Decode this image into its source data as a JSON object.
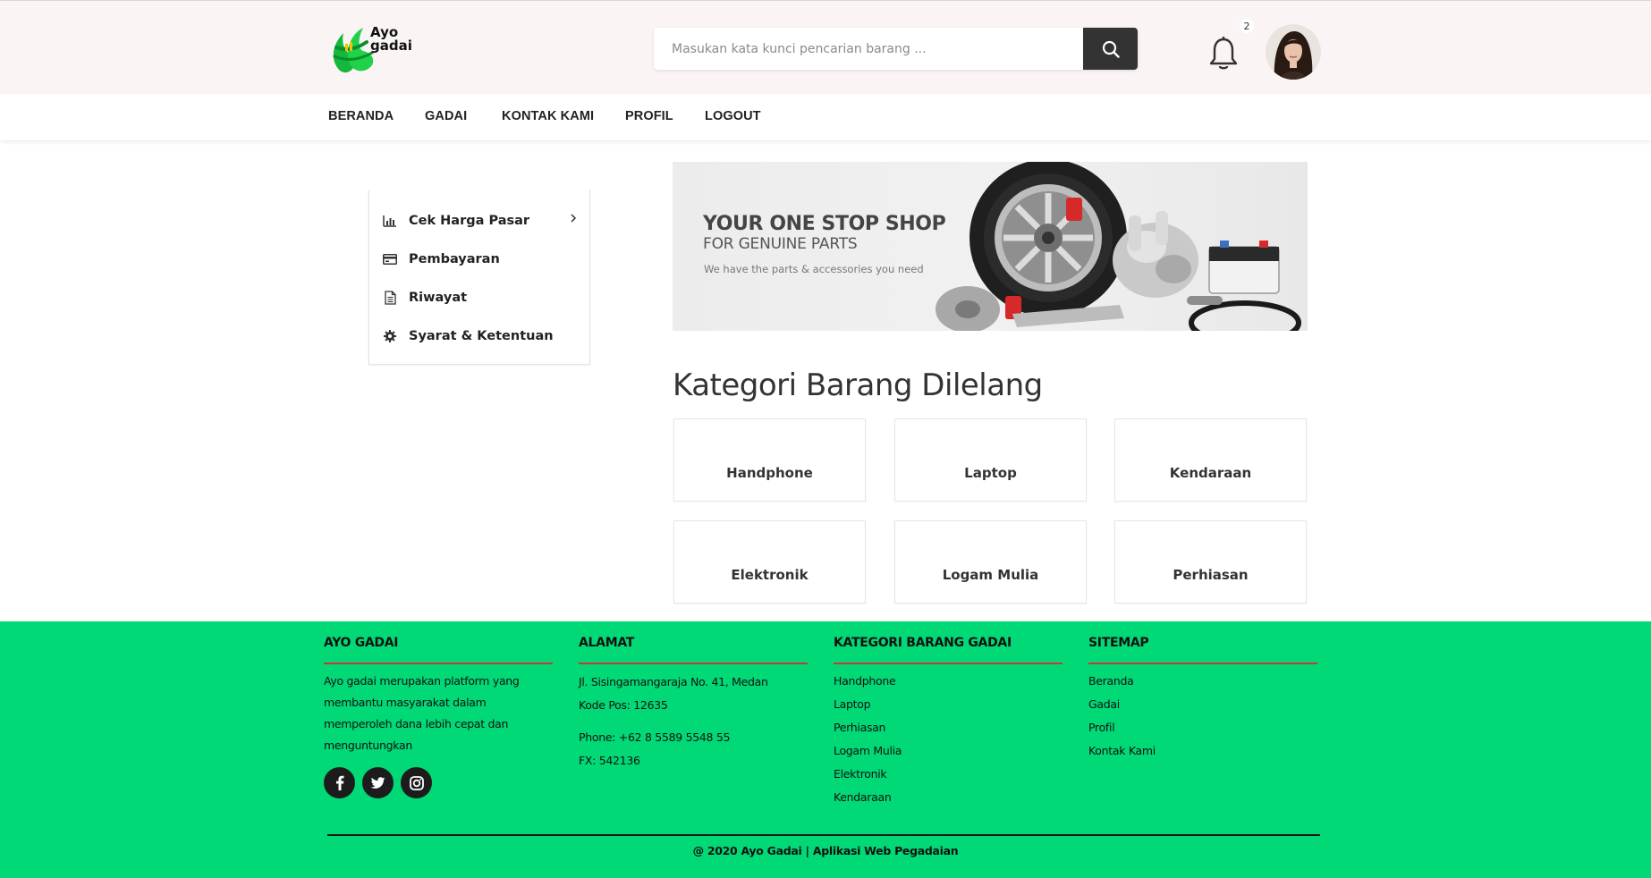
{
  "header": {
    "logo_line1": "Ayo",
    "logo_line2": "gadai",
    "search_placeholder": "Masukan kata kunci pencarian barang ...",
    "search_icon": "search-icon",
    "notification_icon": "bell-icon",
    "notification_count": "2",
    "avatar": "user-avatar"
  },
  "nav": {
    "items": [
      {
        "label": "BERANDA"
      },
      {
        "label": "GADAI"
      },
      {
        "label": "KONTAK KAMI"
      },
      {
        "label": "PROFIL"
      },
      {
        "label": "LOGOUT"
      }
    ]
  },
  "sidebar": {
    "items": [
      {
        "label": "Cek Harga Pasar",
        "icon": "bar-chart-icon"
      },
      {
        "label": "Pembayaran",
        "icon": "credit-card-icon"
      },
      {
        "label": "Riwayat",
        "icon": "document-icon"
      },
      {
        "label": "Syarat & Ketentuan",
        "icon": "gear-icon"
      }
    ]
  },
  "banner": {
    "title": "YOUR ONE STOP SHOP",
    "subtitle": "FOR GENUINE PARTS",
    "tagline": "We have the parts & accessories you need"
  },
  "main": {
    "section_title": "Kategori Barang Dilelang",
    "categories": [
      {
        "label": "Handphone"
      },
      {
        "label": "Laptop"
      },
      {
        "label": "Kendaraan"
      },
      {
        "label": "Elektronik"
      },
      {
        "label": "Logam Mulia"
      },
      {
        "label": "Perhiasan"
      }
    ]
  },
  "footer": {
    "about": {
      "heading": "AYO GADAI",
      "text": "Ayo gadai merupakan platform yang membantu masyarakat dalam memperoleh dana lebih cepat dan menguntungkan"
    },
    "address": {
      "heading": "ALAMAT",
      "street": "Jl. Sisingamangaraja No. 41, Medan",
      "postal": "Kode Pos: 12635",
      "phone": "Phone: +62 8 5589 5548 55",
      "fax": "FX: 542136"
    },
    "categories": {
      "heading": "KATEGORI BARANG GADAI",
      "links": [
        "Handphone",
        "Laptop",
        "Perhiasan",
        "Logam Mulia",
        "Elektronik",
        "Kendaraan"
      ]
    },
    "sitemap": {
      "heading": "SITEMAP",
      "links": [
        "Beranda",
        "Gadai",
        "Profil",
        "Kontak Kami"
      ]
    },
    "copyright": "@ 2020 Ayo Gadai | Aplikasi Web Pegadaian"
  },
  "colors": {
    "footer_bg": "#00d976",
    "header_bg": "#fbf4f4",
    "accent_line": "#c83a3a"
  }
}
